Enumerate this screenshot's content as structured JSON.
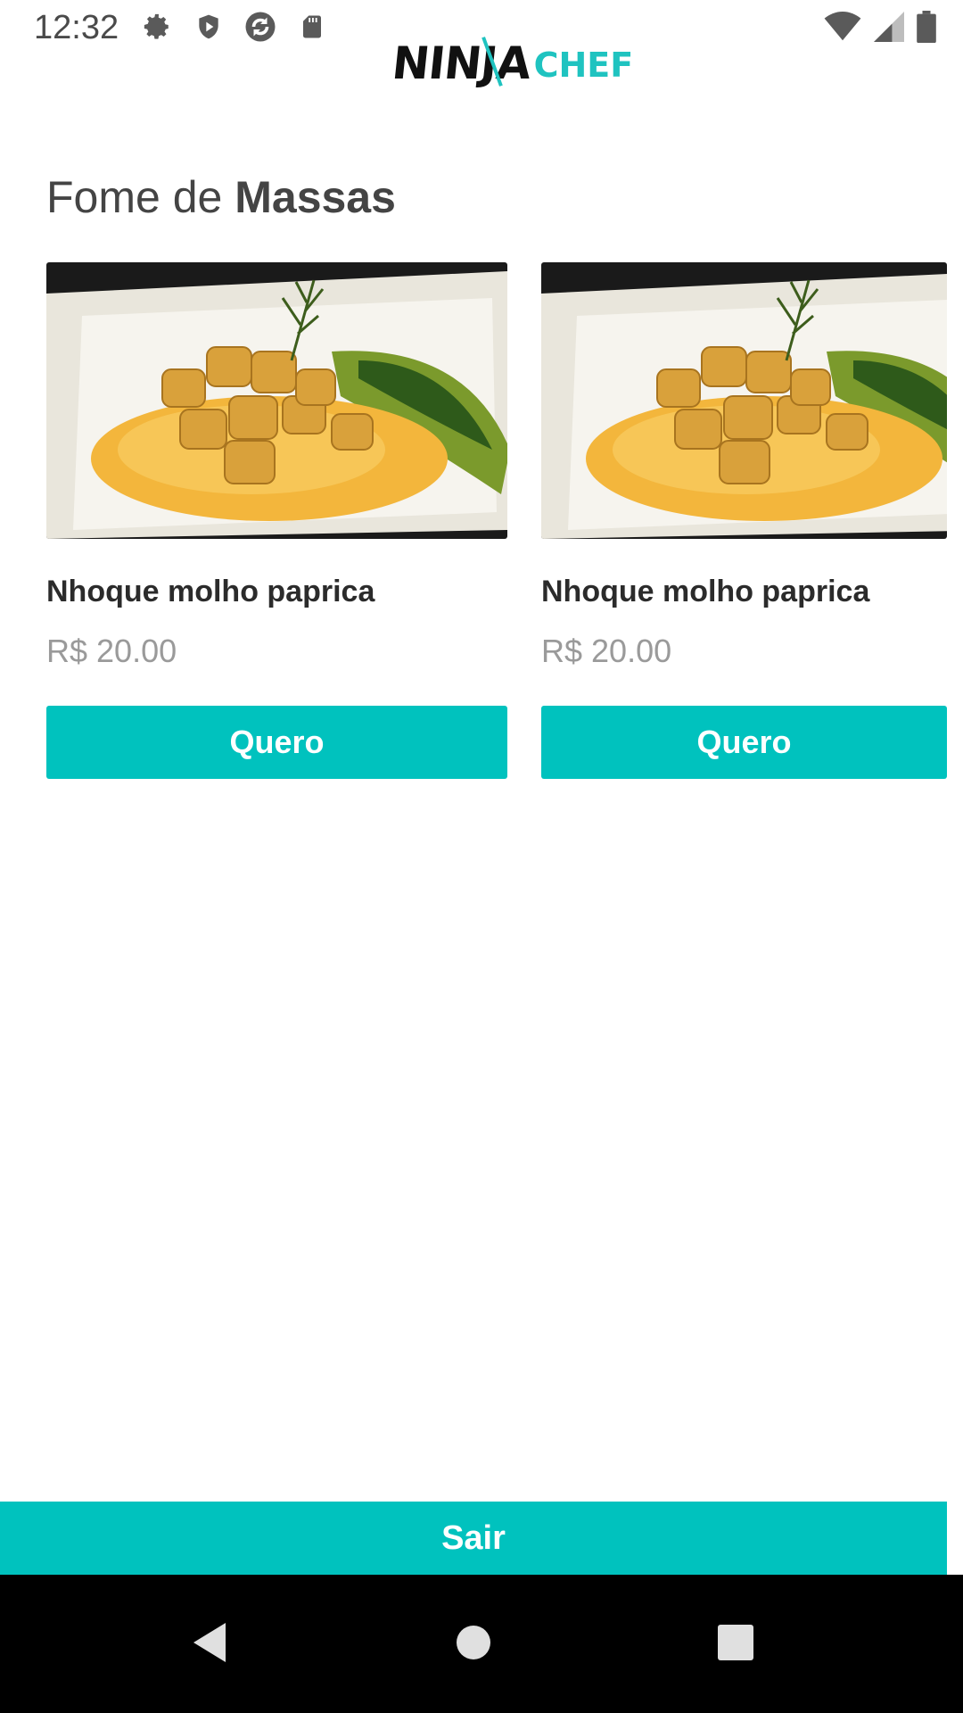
{
  "status_bar": {
    "time": "12:32",
    "icons": [
      "settings-icon",
      "shield-icon",
      "sync-icon",
      "sd-card-icon",
      "wifi-icon",
      "signal-icon",
      "battery-icon"
    ]
  },
  "header": {
    "logo_part1": "NINJA",
    "logo_part2": "CHEF"
  },
  "section": {
    "title_prefix": "Fome de",
    "title_bold": "Massas"
  },
  "products": [
    {
      "name": "Nhoque molho paprica",
      "price": "R$ 20.00",
      "button_label": "Quero"
    },
    {
      "name": "Nhoque molho paprica",
      "price": "R$ 20.00",
      "button_label": "Quero"
    }
  ],
  "footer": {
    "exit_label": "Sair"
  },
  "navigation": [
    "back-icon",
    "home-icon",
    "recents-icon"
  ],
  "colors": {
    "accent": "#00c2be",
    "price": "#9a9a9a",
    "nav_background": "#000000"
  }
}
